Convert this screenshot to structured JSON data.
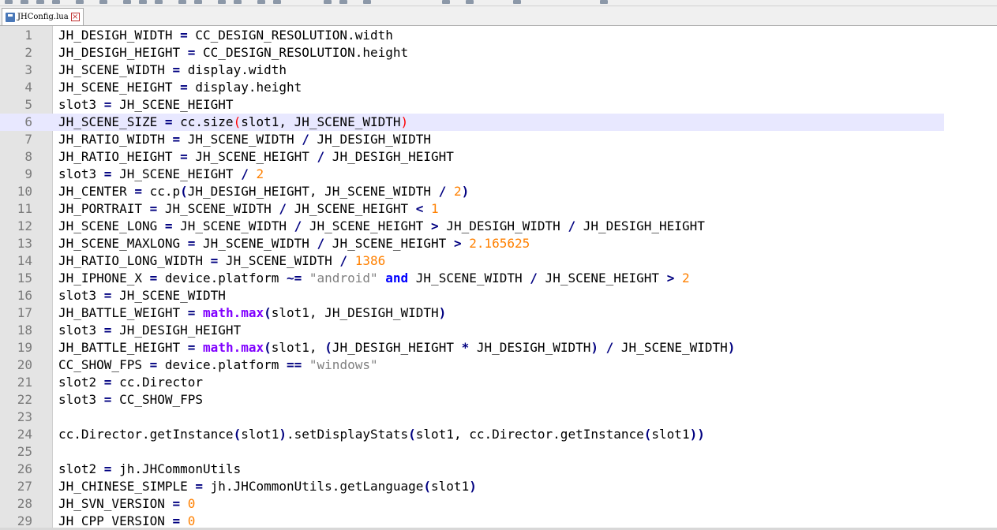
{
  "tab": {
    "label": "JHConfig.lua"
  },
  "current_line": 6,
  "lines": [
    {
      "n": "1",
      "tokens": [
        {
          "t": "JH_DESIGH_WIDTH "
        },
        {
          "t": "=",
          "c": "op"
        },
        {
          "t": " CC_DESIGN_RESOLUTION.width"
        }
      ]
    },
    {
      "n": "2",
      "tokens": [
        {
          "t": "JH_DESIGH_HEIGHT "
        },
        {
          "t": "=",
          "c": "op"
        },
        {
          "t": " CC_DESIGN_RESOLUTION.height"
        }
      ]
    },
    {
      "n": "3",
      "tokens": [
        {
          "t": "JH_SCENE_WIDTH "
        },
        {
          "t": "=",
          "c": "op"
        },
        {
          "t": " display.width"
        }
      ]
    },
    {
      "n": "4",
      "tokens": [
        {
          "t": "JH_SCENE_HEIGHT "
        },
        {
          "t": "=",
          "c": "op"
        },
        {
          "t": " display.height"
        }
      ]
    },
    {
      "n": "5",
      "tokens": [
        {
          "t": "slot3 "
        },
        {
          "t": "=",
          "c": "op"
        },
        {
          "t": " JH_SCENE_HEIGHT"
        }
      ]
    },
    {
      "n": "6",
      "tokens": [
        {
          "t": "JH_SCENE_SIZE "
        },
        {
          "t": "=",
          "c": "op"
        },
        {
          "t": " cc.size"
        },
        {
          "t": "(",
          "c": "paren"
        },
        {
          "t": "slot1, JH_SCENE_WIDTH"
        },
        {
          "t": ")",
          "c": "paren"
        }
      ]
    },
    {
      "n": "7",
      "tokens": [
        {
          "t": "JH_RATIO_WIDTH "
        },
        {
          "t": "=",
          "c": "op"
        },
        {
          "t": " JH_SCENE_WIDTH "
        },
        {
          "t": "/",
          "c": "op"
        },
        {
          "t": " JH_DESIGH_WIDTH"
        }
      ]
    },
    {
      "n": "8",
      "tokens": [
        {
          "t": "JH_RATIO_HEIGHT "
        },
        {
          "t": "=",
          "c": "op"
        },
        {
          "t": " JH_SCENE_HEIGHT "
        },
        {
          "t": "/",
          "c": "op"
        },
        {
          "t": " JH_DESIGH_HEIGHT"
        }
      ]
    },
    {
      "n": "9",
      "tokens": [
        {
          "t": "slot3 "
        },
        {
          "t": "=",
          "c": "op"
        },
        {
          "t": " JH_SCENE_HEIGHT "
        },
        {
          "t": "/",
          "c": "op"
        },
        {
          "t": " "
        },
        {
          "t": "2",
          "c": "num"
        }
      ]
    },
    {
      "n": "10",
      "tokens": [
        {
          "t": "JH_CENTER "
        },
        {
          "t": "=",
          "c": "op"
        },
        {
          "t": " cc.p"
        },
        {
          "t": "(",
          "c": "op"
        },
        {
          "t": "JH_DESIGH_HEIGHT, JH_SCENE_WIDTH "
        },
        {
          "t": "/",
          "c": "op"
        },
        {
          "t": " "
        },
        {
          "t": "2",
          "c": "num"
        },
        {
          "t": ")",
          "c": "op"
        }
      ]
    },
    {
      "n": "11",
      "tokens": [
        {
          "t": "JH_PORTRAIT "
        },
        {
          "t": "=",
          "c": "op"
        },
        {
          "t": " JH_SCENE_WIDTH "
        },
        {
          "t": "/",
          "c": "op"
        },
        {
          "t": " JH_SCENE_HEIGHT "
        },
        {
          "t": "<",
          "c": "op"
        },
        {
          "t": " "
        },
        {
          "t": "1",
          "c": "num"
        }
      ]
    },
    {
      "n": "12",
      "tokens": [
        {
          "t": "JH_SCENE_LONG "
        },
        {
          "t": "=",
          "c": "op"
        },
        {
          "t": " JH_SCENE_WIDTH "
        },
        {
          "t": "/",
          "c": "op"
        },
        {
          "t": " JH_SCENE_HEIGHT "
        },
        {
          "t": ">",
          "c": "op"
        },
        {
          "t": " JH_DESIGH_WIDTH "
        },
        {
          "t": "/",
          "c": "op"
        },
        {
          "t": " JH_DESIGH_HEIGHT"
        }
      ]
    },
    {
      "n": "13",
      "tokens": [
        {
          "t": "JH_SCENE_MAXLONG "
        },
        {
          "t": "=",
          "c": "op"
        },
        {
          "t": " JH_SCENE_WIDTH "
        },
        {
          "t": "/",
          "c": "op"
        },
        {
          "t": " JH_SCENE_HEIGHT "
        },
        {
          "t": ">",
          "c": "op"
        },
        {
          "t": " "
        },
        {
          "t": "2.165625",
          "c": "num"
        }
      ]
    },
    {
      "n": "14",
      "tokens": [
        {
          "t": "JH_RATIO_LONG_WIDTH "
        },
        {
          "t": "=",
          "c": "op"
        },
        {
          "t": " JH_SCENE_WIDTH "
        },
        {
          "t": "/",
          "c": "op"
        },
        {
          "t": " "
        },
        {
          "t": "1386",
          "c": "num"
        }
      ]
    },
    {
      "n": "15",
      "tokens": [
        {
          "t": "JH_IPHONE_X "
        },
        {
          "t": "=",
          "c": "op"
        },
        {
          "t": " device.platform "
        },
        {
          "t": "~=",
          "c": "op"
        },
        {
          "t": " "
        },
        {
          "t": "\"android\"",
          "c": "str"
        },
        {
          "t": " "
        },
        {
          "t": "and",
          "c": "kw"
        },
        {
          "t": " JH_SCENE_WIDTH "
        },
        {
          "t": "/",
          "c": "op"
        },
        {
          "t": " JH_SCENE_HEIGHT "
        },
        {
          "t": ">",
          "c": "op"
        },
        {
          "t": " "
        },
        {
          "t": "2",
          "c": "num"
        }
      ]
    },
    {
      "n": "16",
      "tokens": [
        {
          "t": "slot3 "
        },
        {
          "t": "=",
          "c": "op"
        },
        {
          "t": " JH_SCENE_WIDTH"
        }
      ]
    },
    {
      "n": "17",
      "tokens": [
        {
          "t": "JH_BATTLE_WEIGHT "
        },
        {
          "t": "=",
          "c": "op"
        },
        {
          "t": " "
        },
        {
          "t": "math.max",
          "c": "fn"
        },
        {
          "t": "(",
          "c": "op"
        },
        {
          "t": "slot1, JH_DESIGH_WIDTH"
        },
        {
          "t": ")",
          "c": "op"
        }
      ]
    },
    {
      "n": "18",
      "tokens": [
        {
          "t": "slot3 "
        },
        {
          "t": "=",
          "c": "op"
        },
        {
          "t": " JH_DESIGH_HEIGHT"
        }
      ]
    },
    {
      "n": "19",
      "tokens": [
        {
          "t": "JH_BATTLE_HEIGHT "
        },
        {
          "t": "=",
          "c": "op"
        },
        {
          "t": " "
        },
        {
          "t": "math.max",
          "c": "fn"
        },
        {
          "t": "(",
          "c": "op"
        },
        {
          "t": "slot1, "
        },
        {
          "t": "(",
          "c": "op"
        },
        {
          "t": "JH_DESIGH_HEIGHT "
        },
        {
          "t": "*",
          "c": "op"
        },
        {
          "t": " JH_DESIGH_WIDTH"
        },
        {
          "t": ")",
          "c": "op"
        },
        {
          "t": " "
        },
        {
          "t": "/",
          "c": "op"
        },
        {
          "t": " JH_SCENE_WIDTH"
        },
        {
          "t": ")",
          "c": "op"
        }
      ]
    },
    {
      "n": "20",
      "tokens": [
        {
          "t": "CC_SHOW_FPS "
        },
        {
          "t": "=",
          "c": "op"
        },
        {
          "t": " device.platform "
        },
        {
          "t": "==",
          "c": "op"
        },
        {
          "t": " "
        },
        {
          "t": "\"windows\"",
          "c": "str"
        }
      ]
    },
    {
      "n": "21",
      "tokens": [
        {
          "t": "slot2 "
        },
        {
          "t": "=",
          "c": "op"
        },
        {
          "t": " cc.Director"
        }
      ]
    },
    {
      "n": "22",
      "tokens": [
        {
          "t": "slot3 "
        },
        {
          "t": "=",
          "c": "op"
        },
        {
          "t": " CC_SHOW_FPS"
        }
      ]
    },
    {
      "n": "23",
      "tokens": []
    },
    {
      "n": "24",
      "tokens": [
        {
          "t": "cc.Director.getInstance"
        },
        {
          "t": "(",
          "c": "op"
        },
        {
          "t": "slot1"
        },
        {
          "t": ")",
          "c": "op"
        },
        {
          "t": ".setDisplayStats"
        },
        {
          "t": "(",
          "c": "op"
        },
        {
          "t": "slot1, cc.Director.getInstance"
        },
        {
          "t": "(",
          "c": "op"
        },
        {
          "t": "slot1"
        },
        {
          "t": "))",
          "c": "op"
        }
      ]
    },
    {
      "n": "25",
      "tokens": []
    },
    {
      "n": "26",
      "tokens": [
        {
          "t": "slot2 "
        },
        {
          "t": "=",
          "c": "op"
        },
        {
          "t": " jh.JHCommonUtils"
        }
      ]
    },
    {
      "n": "27",
      "tokens": [
        {
          "t": "JH_CHINESE_SIMPLE "
        },
        {
          "t": "=",
          "c": "op"
        },
        {
          "t": " jh.JHCommonUtils.getLanguage"
        },
        {
          "t": "(",
          "c": "op"
        },
        {
          "t": "slot1"
        },
        {
          "t": ")",
          "c": "op"
        }
      ]
    },
    {
      "n": "28",
      "tokens": [
        {
          "t": "JH_SVN_VERSION "
        },
        {
          "t": "=",
          "c": "op"
        },
        {
          "t": " "
        },
        {
          "t": "0",
          "c": "num"
        }
      ]
    },
    {
      "n": "29",
      "tokens": [
        {
          "t": "JH_CPP_VERSION "
        },
        {
          "t": "=",
          "c": "op"
        },
        {
          "t": " "
        },
        {
          "t": "0",
          "c": "num"
        }
      ]
    }
  ]
}
